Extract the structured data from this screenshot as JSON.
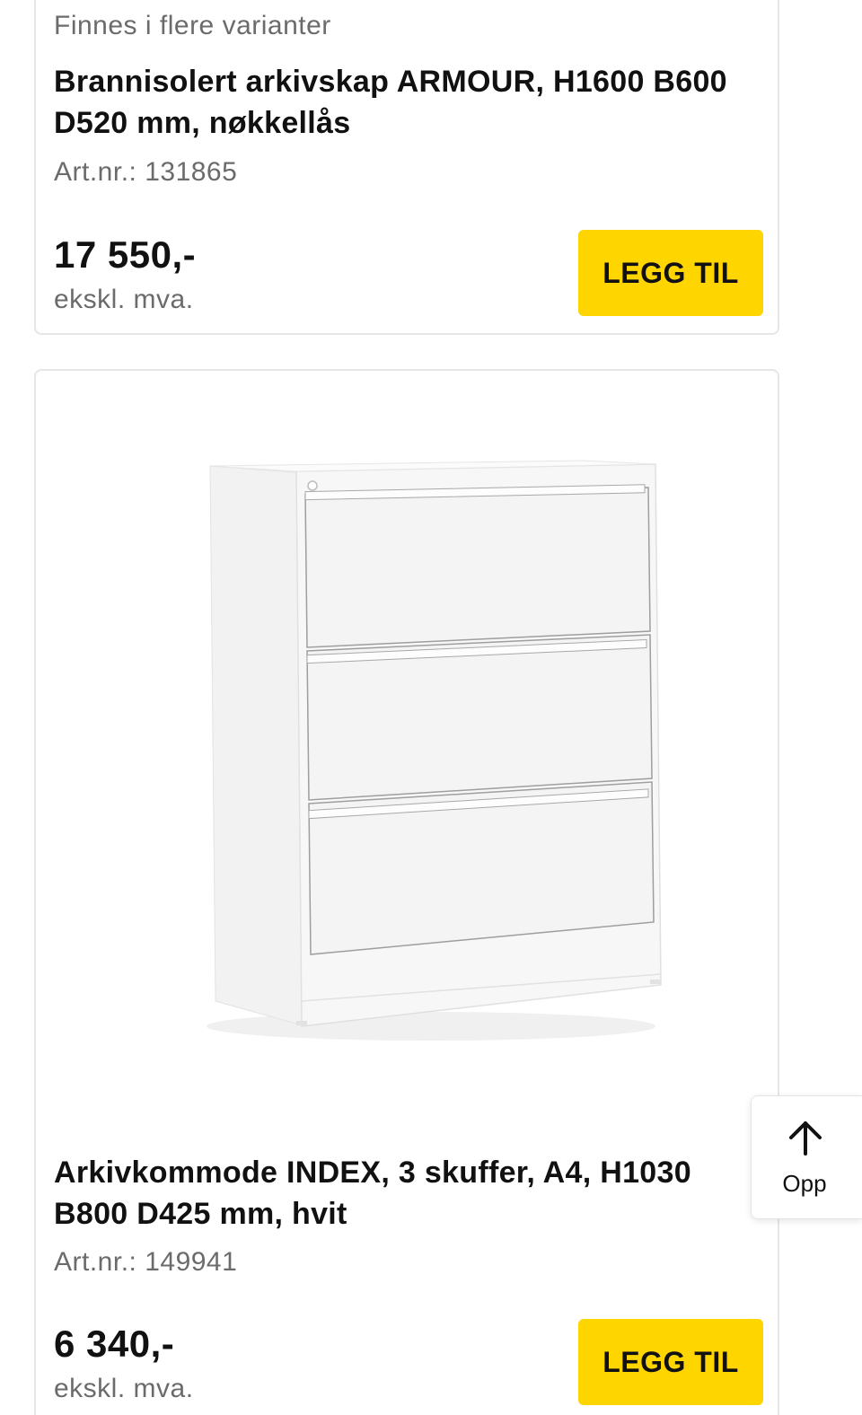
{
  "products": [
    {
      "variant_note": "Finnes i flere varianter",
      "title": "Brannisolert arkivskap ARMOUR, H1600 B600 D520 mm, nøkkellås",
      "art_nr": "Art.nr.: 131865",
      "price": "17 550,-",
      "vat_note": "ekskl. mva.",
      "add_label": "LEGG TIL"
    },
    {
      "image": "filing-cabinet-3-drawers-white",
      "title": "Arkivkommode INDEX, 3 skuffer, A4, H1030 B800 D425 mm, hvit",
      "art_nr": "Art.nr.: 149941",
      "price": "6 340,-",
      "vat_note": "ekskl. mva.",
      "add_label": "LEGG TIL"
    }
  ],
  "scroll_top": {
    "icon": "arrow-up-icon",
    "label": "Opp"
  },
  "colors": {
    "accent": "#ffd500",
    "muted_text": "#6b6b6b",
    "card_border": "#e6e6e6"
  }
}
